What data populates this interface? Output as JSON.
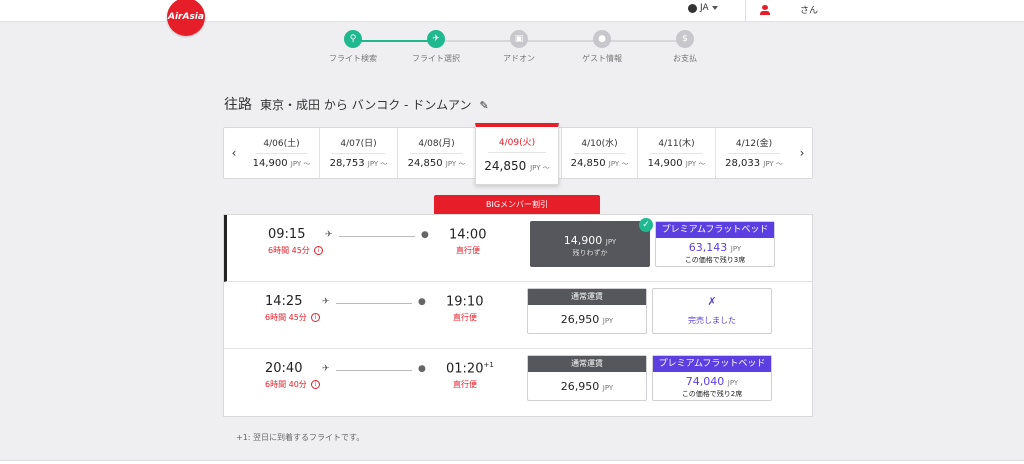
{
  "header": {
    "logo_text": "AirAsia",
    "language": "JA",
    "user_suffix": "さん"
  },
  "steps": [
    {
      "label": "フライト検索",
      "icon": "search-icon"
    },
    {
      "label": "フライト選択",
      "icon": "plane-icon"
    },
    {
      "label": "アドオン",
      "icon": "cart-icon"
    },
    {
      "label": "ゲスト情報",
      "icon": "person-icon"
    },
    {
      "label": "お支払",
      "icon": "dollar-icon"
    }
  ],
  "route": {
    "direction": "往路",
    "text": "東京・成田 から バンコク - ドンムアン"
  },
  "dates": [
    {
      "date": "4/06(土)",
      "price": "14,900",
      "unit": "JPY ～"
    },
    {
      "date": "4/07(日)",
      "price": "28,753",
      "unit": "JPY ～"
    },
    {
      "date": "4/08(月)",
      "price": "24,850",
      "unit": "JPY ～"
    },
    {
      "date": "4/09(火)",
      "price": "24,850",
      "unit": "JPY ～"
    },
    {
      "date": "4/10(水)",
      "price": "24,850",
      "unit": "JPY ～"
    },
    {
      "date": "4/11(木)",
      "price": "14,900",
      "unit": "JPY ～"
    },
    {
      "date": "4/12(金)",
      "price": "28,033",
      "unit": "JPY ～"
    }
  ],
  "banner": "BIGメンバー割引",
  "flights": [
    {
      "dep": "09:15",
      "arr": "14:00",
      "arr_sup": "",
      "duration": "6時間 45分",
      "type": "直行便",
      "std": {
        "header": "",
        "price": "14,900",
        "unit": "JPY",
        "note": "残りわずか"
      },
      "prem": {
        "header": "プレミアムフラットベッド",
        "price": "63,143",
        "unit": "JPY",
        "note": "この価格で残り3席"
      }
    },
    {
      "dep": "14:25",
      "arr": "19:10",
      "arr_sup": "",
      "duration": "6時間 45分",
      "type": "直行便",
      "std": {
        "header": "通常運賃",
        "price": "26,950",
        "unit": "JPY",
        "note": ""
      },
      "soldout": "完売しました"
    },
    {
      "dep": "20:40",
      "arr": "01:20",
      "arr_sup": "+1",
      "duration": "6時間 40分",
      "type": "直行便",
      "std": {
        "header": "通常運賃",
        "price": "26,950",
        "unit": "JPY",
        "note": ""
      },
      "prem": {
        "header": "プレミアムフラットベッド",
        "price": "74,040",
        "unit": "JPY",
        "note": "この価格で残り2席"
      }
    }
  ],
  "footnote": "+1: 翌日に到着するフライトです。",
  "colors": {
    "brand": "#e61e2a",
    "success": "#1fb88f",
    "premium": "#5b3fe0",
    "dark": "#56575c"
  }
}
